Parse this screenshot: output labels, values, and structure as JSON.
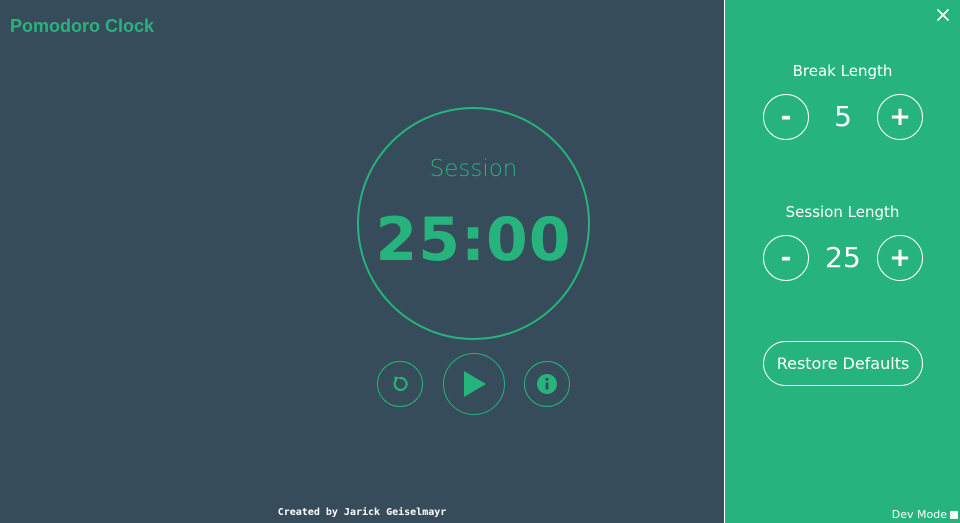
{
  "app": {
    "title": "Pomodoro Clock",
    "footer": "Created by Jarick Geiselmayr"
  },
  "clock": {
    "label": "Session",
    "time": "25:00"
  },
  "controls": {
    "reset_icon": "reset-icon",
    "play_icon": "play-icon",
    "info_icon": "info-icon"
  },
  "settings": {
    "break": {
      "label": "Break Length",
      "value": "5",
      "decrement_label": "-",
      "increment_label": "+"
    },
    "session": {
      "label": "Session Length",
      "value": "25",
      "decrement_label": "-",
      "increment_label": "+"
    },
    "restore_label": "Restore Defaults",
    "dev_mode_label": "Dev Mode",
    "close_icon": "close-icon"
  },
  "colors": {
    "background": "#364c5a",
    "accent": "#26b37d",
    "text_light": "#ffffff"
  }
}
